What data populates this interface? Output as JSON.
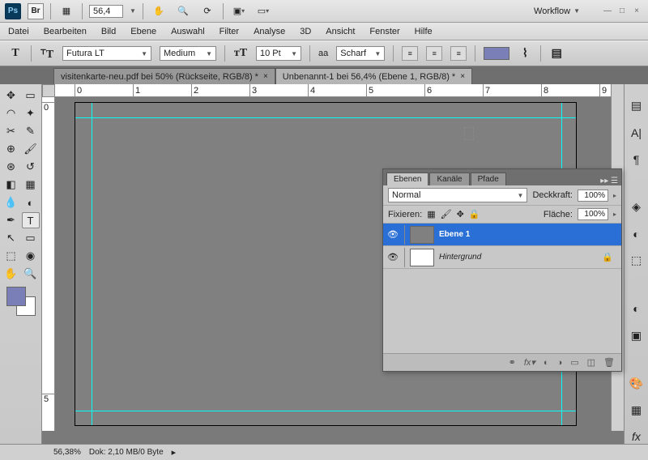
{
  "topbar": {
    "zoom": "56,4",
    "workflow": "Workflow"
  },
  "menu": [
    "Datei",
    "Bearbeiten",
    "Bild",
    "Ebene",
    "Auswahl",
    "Filter",
    "Analyse",
    "3D",
    "Ansicht",
    "Fenster",
    "Hilfe"
  ],
  "options": {
    "font": "Futura LT",
    "weight": "Medium",
    "size": "10 Pt",
    "aa_label": "aa",
    "aa": "Scharf"
  },
  "tabs": [
    {
      "label": "visitenkarte-neu.pdf bei 50% (Rückseite, RGB/8) *"
    },
    {
      "label": "Unbenannt-1 bei 56,4% (Ebene 1, RGB/8) *"
    }
  ],
  "ruler_h": [
    "0",
    "1",
    "2",
    "3",
    "4",
    "5",
    "6",
    "7",
    "8",
    "9"
  ],
  "ruler_v": [
    "0",
    "5"
  ],
  "status": {
    "zoom": "56,38%",
    "doc": "Dok: 2,10 MB/0 Byte"
  },
  "layers_panel": {
    "tabs": [
      "Ebenen",
      "Kanäle",
      "Pfade"
    ],
    "mode": "Normal",
    "opacity_label": "Deckkraft:",
    "opacity": "100%",
    "lock_label": "Fixieren:",
    "fill_label": "Fläche:",
    "fill": "100%",
    "layers": [
      {
        "name": "Ebene 1",
        "locked": false,
        "thumb": "#808080",
        "selected": true,
        "italic": false
      },
      {
        "name": "Hintergrund",
        "locked": true,
        "thumb": "#ffffff",
        "selected": false,
        "italic": true
      }
    ]
  }
}
